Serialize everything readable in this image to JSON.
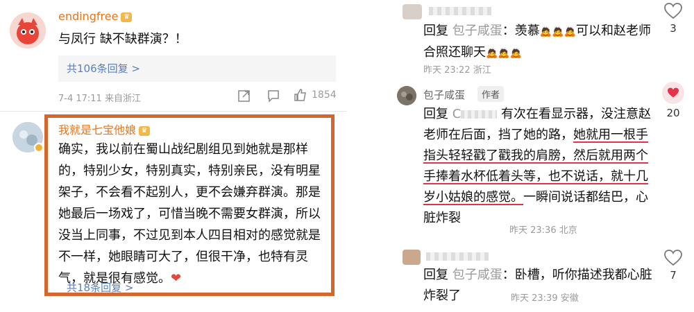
{
  "left": {
    "top_comment": {
      "username": "endingfree",
      "text": "与凤行 缺不缺群演？！",
      "replies_label": "共106条回复 >",
      "meta": "7-4 17:11 来自浙江",
      "likes": "1854"
    },
    "highlight_comment": {
      "username": "我就是七宝他娘",
      "text": "确实，我以前在蜀山战纪剧组见到她就是那样的，特别少女，特别真实，特别亲民，没有明星架子，不会看不起别人，更不会嫌弃群演。那是她最后一场戏了，可惜当晚不需要女群演，所以没当上同事，不过见到本人四目相对的感觉就是不一样，她眼睛可大了，但很干净，也特有灵气，就是很有感觉。",
      "replies_label": "共18条回复 >"
    }
  },
  "right": {
    "reply1": {
      "prefix": "回复",
      "target": "包子咸蛋",
      "text_a": "：羡慕",
      "text_b": "可以和赵老师合照还聊天",
      "meta": "昨天 23:22 浙江",
      "likes": "3"
    },
    "author_comment": {
      "username": "包子咸蛋",
      "badge": "作者",
      "prefix": "回复",
      "mention": "C",
      "text_1": "有次在看显示器，没注意赵老师在后面，挡了她的路，",
      "text_underlined": "她就用一根手指头轻轻戳了戳我的肩膀，然后就用两个手捧着水杯低着头等，也不说话，就十几岁小姑娘的感觉。",
      "text_2": "一瞬间说话都结巴，心脏炸裂",
      "meta": "昨天 23:36 北京",
      "likes": "20"
    },
    "reply2": {
      "prefix": "回复",
      "target": "包子咸蛋",
      "text": "：卧槽，听你描述我都心脏炸裂了",
      "meta": "昨天 23:39 安徽",
      "likes": "7"
    }
  }
}
